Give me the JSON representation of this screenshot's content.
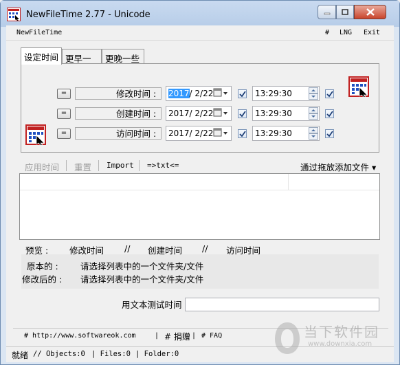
{
  "window": {
    "title": "NewFileTime 2.77 - Unicode"
  },
  "menubar": {
    "app": "NewFileTime",
    "hash": "#",
    "lng": "LNG",
    "exit": "Exit"
  },
  "tabs": [
    {
      "label": "设定时间",
      "active": true
    },
    {
      "label": "更早一些",
      "active": false
    },
    {
      "label": "更晚一些",
      "active": false
    }
  ],
  "rows": [
    {
      "eq": "=",
      "label": "修改时间 :",
      "date_sel": "2017",
      "date_rest": "/  2/22",
      "checked_date": true,
      "time": "13:29:30",
      "checked_time": true
    },
    {
      "eq": "=",
      "label": "创建时间 :",
      "date_sel": "",
      "date_rest": "2017/  2/22",
      "checked_date": true,
      "time": "13:29:30",
      "checked_time": true
    },
    {
      "eq": "=",
      "label": "访问时间 :",
      "date_sel": "",
      "date_rest": "2017/  2/22",
      "checked_date": true,
      "time": "13:29:30",
      "checked_time": true
    }
  ],
  "toolbar": {
    "apply": "应用时间",
    "reset": "重置",
    "import": "Import",
    "txt": "=>txt<=",
    "drag_add": "通过拖放添加文件 ▾"
  },
  "preview": {
    "label": "预览 :",
    "modify": "修改时间",
    "sep1": "//",
    "create": "创建时间",
    "sep2": "//",
    "access": "访问时间",
    "original_label": "原本的 :",
    "original_value": "请选择列表中的一个文件夹/文件",
    "modified_label": "修改后的 :",
    "modified_value": "请选择列表中的一个文件夹/文件"
  },
  "test_text": {
    "label": "用文本测试时间",
    "value": ""
  },
  "footer": {
    "website": "# http://www.softwareok.com",
    "sep1": "|",
    "donate": "# 捐赠",
    "sep2": "|",
    "faq": "# FAQ"
  },
  "status": {
    "ready": "就绪",
    "objects": "// Objects:0",
    "files": "| Files:0",
    "folders": "| Folder:0"
  },
  "watermark": {
    "main": "当下软件园",
    "sub": "www.downxia.com"
  },
  "colors": {
    "selection": "#3399ff",
    "close_button": "#c9452c",
    "disabled_text": "#9b9b9b"
  }
}
